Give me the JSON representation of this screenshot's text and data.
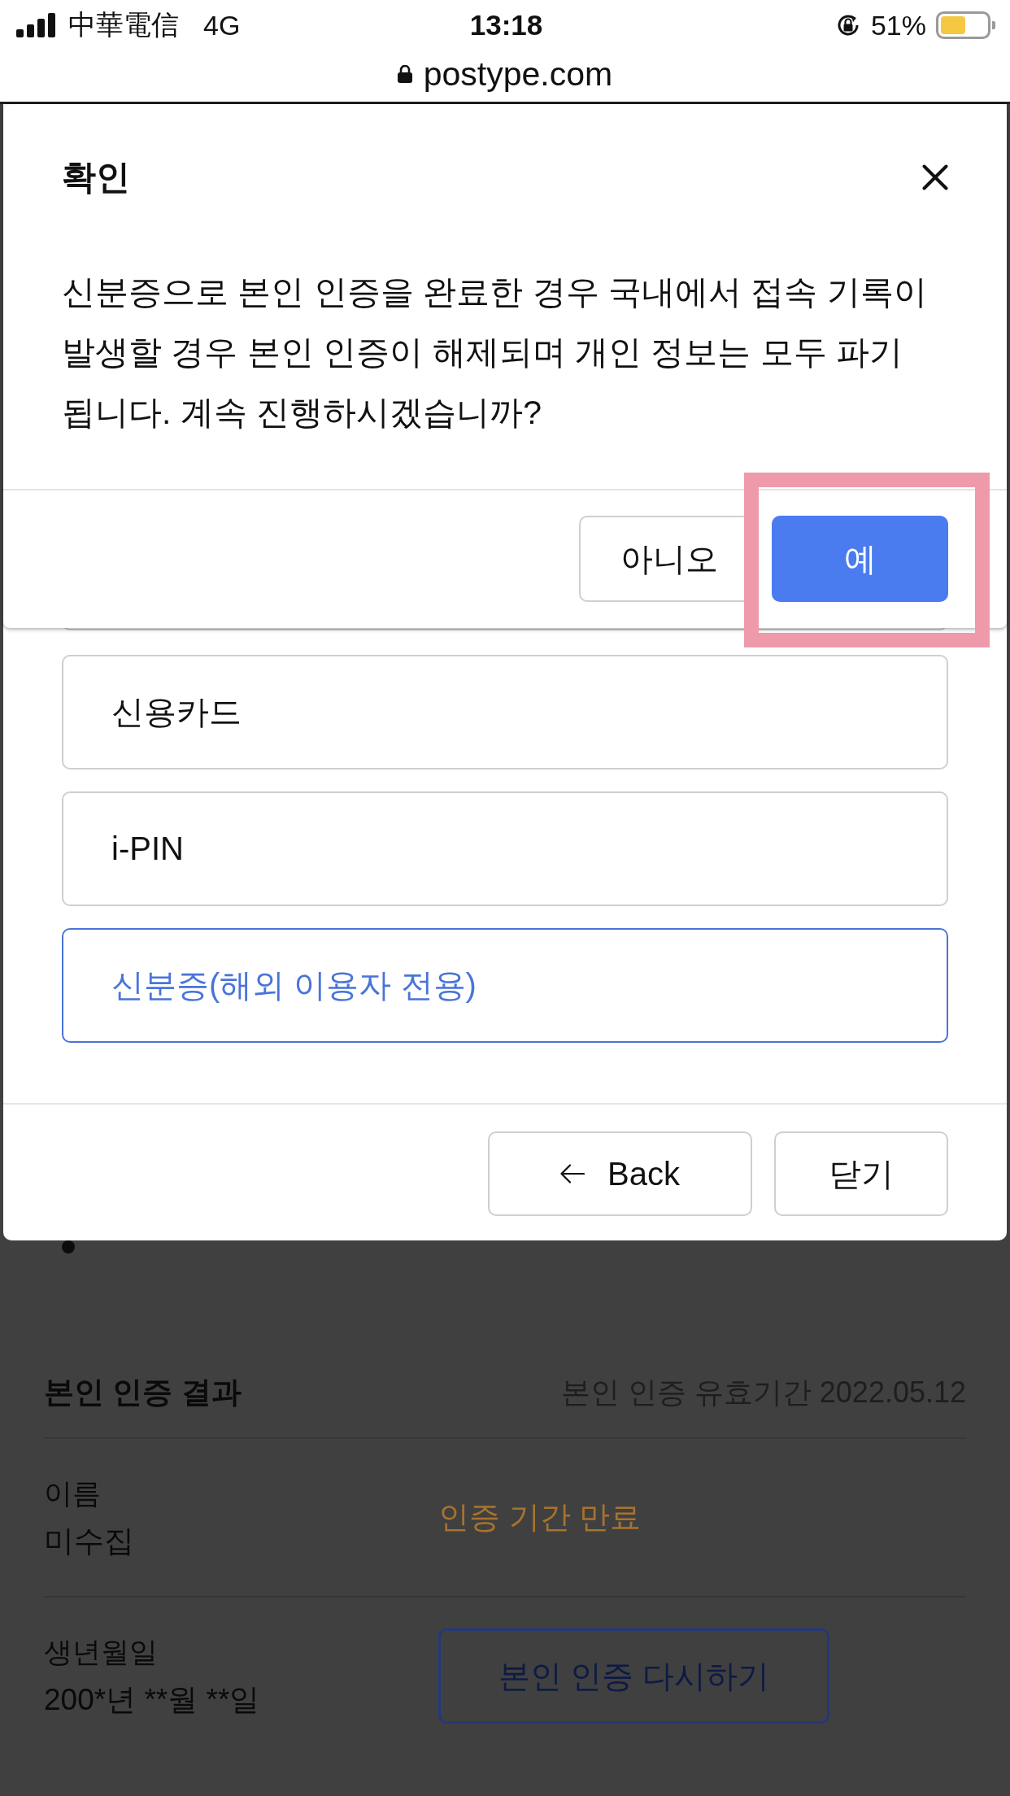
{
  "status_bar": {
    "carrier": "中華電信",
    "network": "4G",
    "time": "13:18",
    "battery": "51%"
  },
  "address_bar": {
    "url": "postype.com"
  },
  "confirm_dialog": {
    "title": "확인",
    "message": "신분증으로 본인 인증을 완료한 경우 국내에서 접속 기록이 발생할 경우 본인 인증이 해제되며 개인 정보는 모두 파기 됩니다. 계속 진행하시겠습니까?",
    "buttons": [
      {
        "label": "아니오",
        "kind": "secondary",
        "highlighted": false
      },
      {
        "label": "예",
        "kind": "primary",
        "highlighted": true
      }
    ]
  },
  "selection_dialog": {
    "options": [
      {
        "label": "신용카드",
        "selected": false
      },
      {
        "label": "i-PIN",
        "selected": false
      },
      {
        "label": "신분증(해외 이용자 전용)",
        "selected": true
      }
    ],
    "buttons": [
      {
        "label": "Back",
        "kind": "back"
      },
      {
        "label": "닫기",
        "kind": "plain"
      }
    ]
  },
  "verification_result": {
    "title": "본인 인증 결과",
    "validity": "본인 인증 유효기간 2022.05.12",
    "rows": [
      {
        "label": "이름",
        "value": "미수집",
        "kind": "status",
        "status": "인증 기간 만료"
      },
      {
        "label": "생년월일",
        "value": "200*년 **월 **일",
        "kind": "action",
        "action": "본인 인증 다시하기"
      }
    ]
  }
}
